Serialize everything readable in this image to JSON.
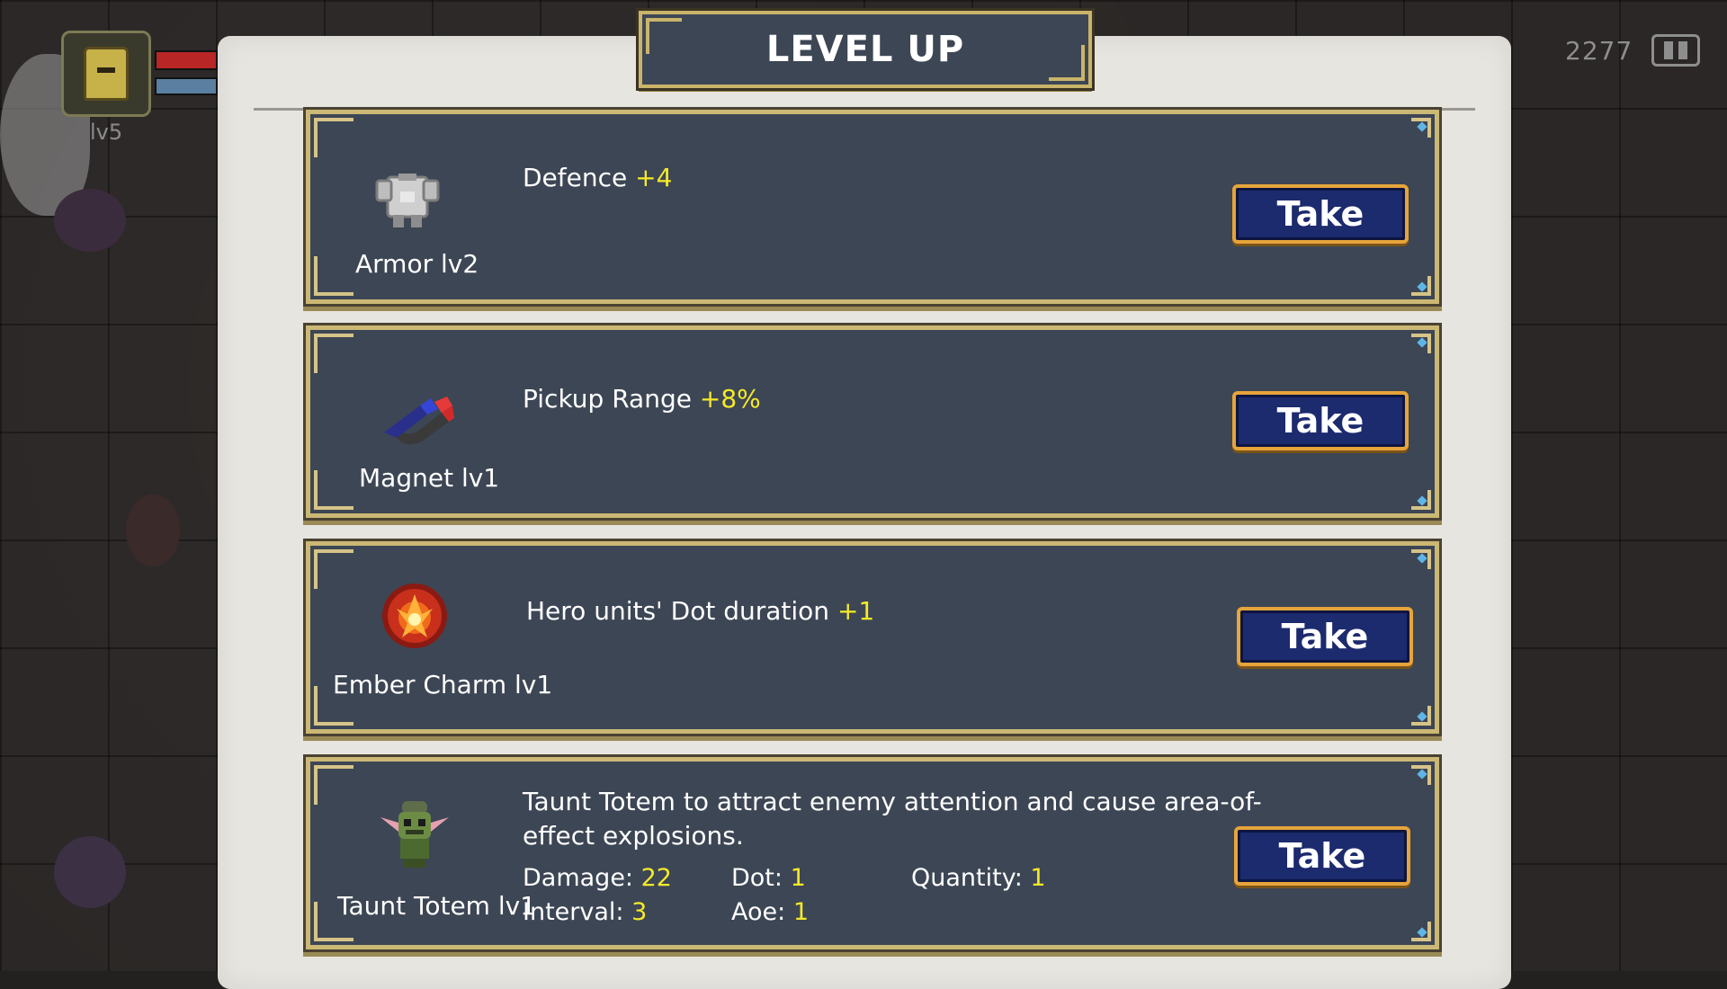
{
  "hud": {
    "level": "lv5",
    "score": "2277",
    "pause_icon": "pause-icon"
  },
  "title": "LEVEL UP",
  "colors": {
    "card_bg": "#3d4654",
    "card_border": "#cbb875",
    "highlight": "#f4ea2a",
    "button_bg": "#1c2a6e",
    "button_border": "#e6a43a",
    "panel": "#e7e5e0"
  },
  "cards": [
    {
      "icon": "armor-icon",
      "name": "Armor lv2",
      "desc_text": "Defence ",
      "desc_value": "+4",
      "button": "Take"
    },
    {
      "icon": "magnet-icon",
      "name": "Magnet lv1",
      "desc_text": "Pickup Range ",
      "desc_value": "+8%",
      "button": "Take"
    },
    {
      "icon": "ember-charm-icon",
      "name": "Ember Charm lv1",
      "desc_text": "Hero units' Dot duration ",
      "desc_value": "+1",
      "button": "Take"
    },
    {
      "icon": "taunt-totem-icon",
      "name": "Taunt Totem lv1",
      "desc_line1": "Taunt Totem to attract enemy attention and cause area-of-",
      "desc_line2": "effect explosions.",
      "stats": {
        "damage_label": "Damage: ",
        "damage_value": "22",
        "dot_label": "Dot: ",
        "dot_value": "1",
        "quantity_label": "Quantity: ",
        "quantity_value": "1",
        "interval_label": "Interval: ",
        "interval_value": "3",
        "aoe_label": "Aoe: ",
        "aoe_value": "1"
      },
      "button": "Take"
    }
  ]
}
